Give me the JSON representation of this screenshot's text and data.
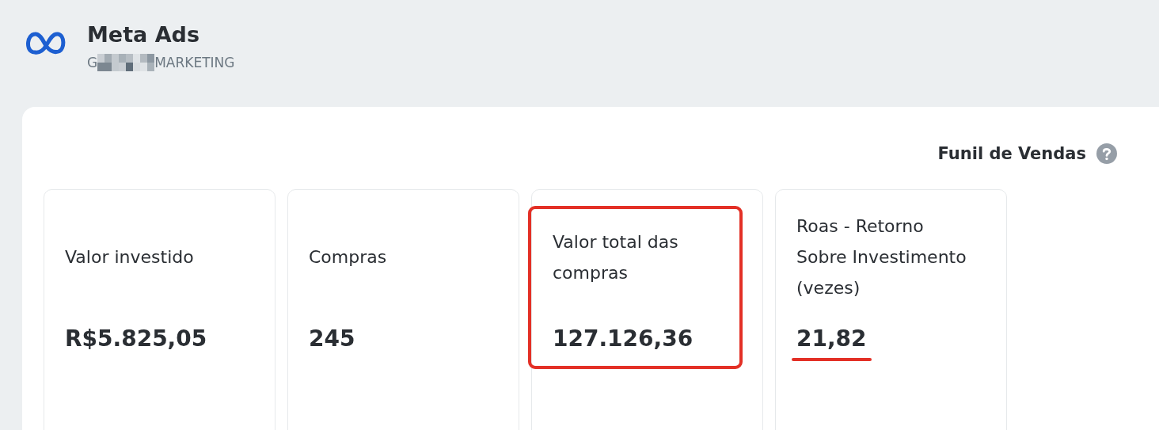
{
  "header": {
    "title": "Meta Ads",
    "subtitle_start": "G",
    "subtitle_end": "MARKETING",
    "subtitle_redacted": true
  },
  "section": {
    "title": "Funil de Vendas"
  },
  "cards": [
    {
      "label": "Valor investido",
      "value": "R$5.825,05",
      "boxed": false,
      "underlined": false
    },
    {
      "label": "Compras",
      "value": "245",
      "boxed": false,
      "underlined": false
    },
    {
      "label": "Valor total das compras",
      "value": "127.126,36",
      "boxed": true,
      "underlined": false
    },
    {
      "label": "Roas - Retorno Sobre Investimento (vezes)",
      "value": "21,82",
      "boxed": false,
      "underlined": true
    }
  ]
}
